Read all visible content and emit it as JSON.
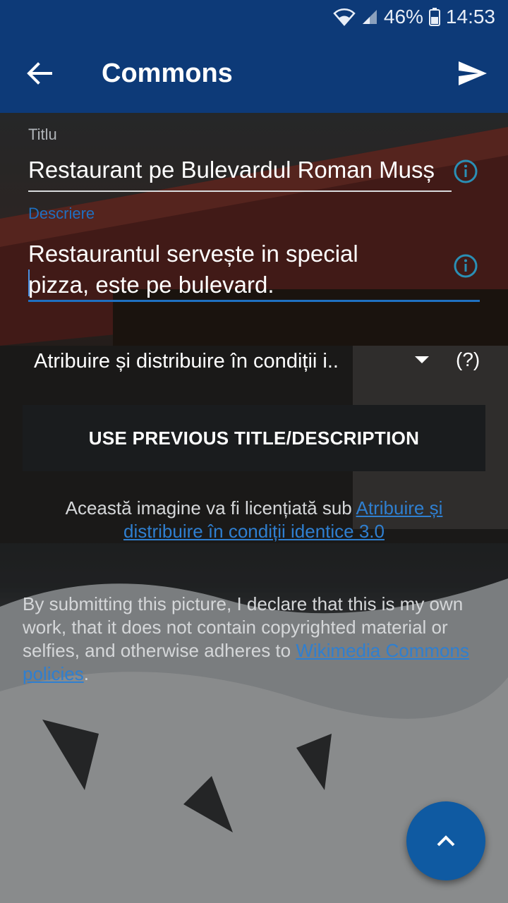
{
  "status_bar": {
    "battery": "46%",
    "time": "14:53",
    "icons": [
      "wifi-icon",
      "signal-icon",
      "battery-icon"
    ]
  },
  "app_bar": {
    "title": "Commons",
    "back_icon": "arrow-left-icon",
    "send_icon": "send-icon"
  },
  "form": {
    "title_label": "Titlu",
    "title_value": "Restaurant pe Bulevardul Roman Musș",
    "description_label": "Descriere",
    "description_value_line1": "Restaurantul servește in special",
    "description_value_line2": "pizza, este pe bulevard.",
    "info_icon": "info-icon"
  },
  "license": {
    "selected": "Atribuire și distribuire în condiții i..",
    "help": "(?)",
    "dropdown_icon": "dropdown-arrow-icon"
  },
  "actions": {
    "use_previous": "USE PREVIOUS TITLE/DESCRIPTION"
  },
  "license_note": {
    "prefix": "Această imagine va fi licențiată sub ",
    "link": "Atribuire și distribuire în condiții identice 3.0"
  },
  "declaration": {
    "text": "By submitting this picture, I declare that this is my own work, that it does not contain copyrighted material or selfies, and otherwise adheres to ",
    "link": "Wikimedia Commons policies",
    "suffix": "."
  },
  "fab": {
    "icon": "chevron-up-icon"
  },
  "colors": {
    "primary": "#0d3a78",
    "accent": "#1f70c1",
    "fab": "#0f5aa2"
  }
}
